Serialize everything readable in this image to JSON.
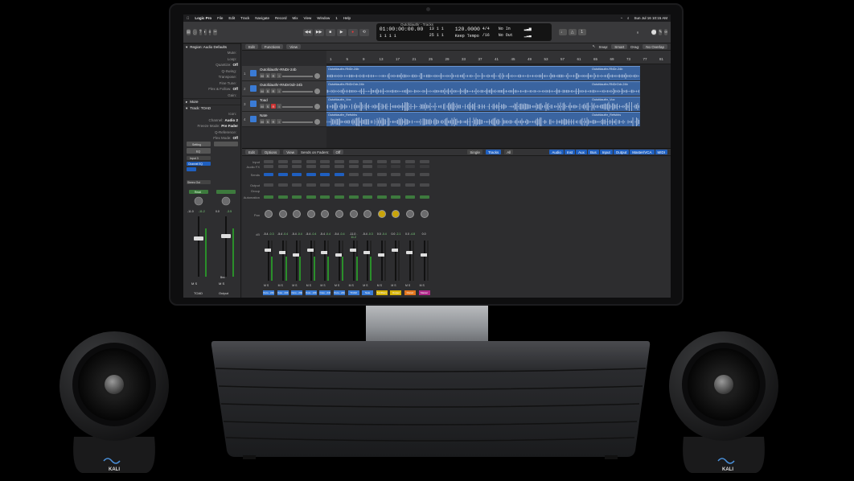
{
  "menubar": {
    "apple": "",
    "app": "Logic Pro",
    "items": [
      "File",
      "Edit",
      "Track",
      "Navigate",
      "Record",
      "Mix",
      "View",
      "Window",
      "1",
      "Help"
    ],
    "clock": "Sun Jul 16  10:15 AM"
  },
  "window_title": "Outofdauthr - Tracks",
  "lcd": {
    "time": "01:00:00:00.00",
    "bars": "1   1   1     1",
    "bars2": "13   1   1",
    "bars3": "25   1   1",
    "tempo": "120.0000",
    "tempo_label": "Keep Tempo",
    "sig": "4/4",
    "div": "/16",
    "in": "No In",
    "out": "No Out"
  },
  "inspector": {
    "region_label": "Region: Audio Defaults",
    "rows": [
      [
        "Mute:",
        ""
      ],
      [
        "Loop:",
        ""
      ],
      [
        "Quantize:",
        "Off"
      ],
      [
        "Q-Swing:",
        ""
      ],
      [
        "Transpose:",
        ""
      ],
      [
        "Fine Tune:",
        ""
      ],
      [
        "Flex & Follow:",
        "Off"
      ],
      [
        "Gain:",
        ""
      ]
    ],
    "more": "More",
    "track_label": "Track: TOAD",
    "track_rows": [
      [
        "Icon:",
        ""
      ],
      [
        "Channel:",
        "Audio 2"
      ],
      [
        "Freeze Mode:",
        "Pre Fader"
      ],
      [
        "Q-Reference:",
        ""
      ],
      [
        "Flex Mode:",
        "Off"
      ]
    ],
    "strip_names": [
      "TOAD",
      "Output"
    ],
    "vals": [
      "-11.0",
      "-11.2",
      "0.0",
      "-3.5"
    ],
    "channel_setting": "Setting",
    "eq": "EQ",
    "input": "Input 3",
    "channel_eq": "Channel EQ",
    "stereo_out": "Stereo Out",
    "read": "Read",
    "bnc": "Bnc"
  },
  "tracks": {
    "bar": {
      "edit": "Edit",
      "functions": "Functions",
      "view": "View",
      "snap_label": "Snap:",
      "snap": "Smart",
      "drag_label": "Drag:",
      "drag": "No Overlap"
    },
    "ruler": [
      "1",
      "5",
      "9",
      "13",
      "17",
      "21",
      "25",
      "29",
      "33",
      "37",
      "41",
      "45",
      "49",
      "53",
      "57",
      "61",
      "65",
      "69",
      "73",
      "77",
      "81"
    ],
    "list": [
      {
        "num": "1",
        "name": "Outofdauthr-RNDr-24b"
      },
      {
        "num": "2",
        "name": "Outofdauthr-RNDrOdr-24b"
      },
      {
        "num": "3",
        "name": "Toad"
      },
      {
        "num": "4",
        "name": "Nate"
      }
    ],
    "regions": [
      [
        "Outofdauthr-RNDr-24b",
        "Outofdauthr-RNDr-24b"
      ],
      [
        "Outofdauthr-RNDrOdr-24b",
        "Outofdauthr-RNDrOdr-24b"
      ],
      [
        "Outofdauthr_Vox",
        "Outofdauthr_Vox"
      ],
      [
        "Outofdauthr_Refshhs",
        "Outofdauthr_Refshhs"
      ]
    ]
  },
  "mixer": {
    "bar": {
      "edit": "Edit",
      "options": "Options",
      "view": "View",
      "sends": "Sends on Faders:",
      "sends_val": "Off",
      "single": "Single",
      "tracks": "Tracks",
      "all": "All"
    },
    "filters": [
      "Audio",
      "Inst",
      "Aux",
      "Bus",
      "Input",
      "Output",
      "Master/VCA",
      "MIDI"
    ],
    "row_labels": [
      "Input",
      "Audio FX",
      "Sends",
      "Output",
      "Group",
      "Automation",
      "Pan",
      "dB"
    ],
    "strips": [
      {
        "name": "Outo...24b",
        "color": "#3a7bd5",
        "v1": "-5.4",
        "v2": "-0.3"
      },
      {
        "name": "Outo...24b",
        "color": "#3a7bd5",
        "v1": "-5.4",
        "v2": "-0.4"
      },
      {
        "name": "Outo...24b",
        "color": "#3a7bd5",
        "v1": "-5.4",
        "v2": "-0.4"
      },
      {
        "name": "Outo...24b",
        "color": "#3a7bd5",
        "v1": "-5.4",
        "v2": "-0.4"
      },
      {
        "name": "Outo...24b",
        "color": "#3a7bd5",
        "v1": "-5.4",
        "v2": "-0.4"
      },
      {
        "name": "Outo...24b",
        "color": "#3a7bd5",
        "v1": "-5.4",
        "v2": "-0.4"
      },
      {
        "name": "TOAD",
        "color": "#3a7bd5",
        "v1": "-11.0",
        "v2": "-11.2"
      },
      {
        "name": "Nate",
        "color": "#3a7bd5",
        "v1": "-5.4",
        "v2": "-0.3"
      },
      {
        "name": "Tubfilters",
        "color": "#d6b40a",
        "v1": "0.0",
        "v2": "-0.4"
      },
      {
        "name": "Output",
        "color": "#d6b40a",
        "v1": "0.0",
        "v2": "-2.1"
      },
      {
        "name": "Distort",
        "color": "#e0751e",
        "v1": "0.0",
        "v2": "-4.8"
      },
      {
        "name": "Master",
        "color": "#b02a8a",
        "v1": "0.0",
        "v2": ""
      }
    ]
  },
  "hardware": {
    "speaker_brand": "KALI",
    "colors": {
      "accent": "#1f5fbf",
      "region": "#3a64a0"
    }
  }
}
